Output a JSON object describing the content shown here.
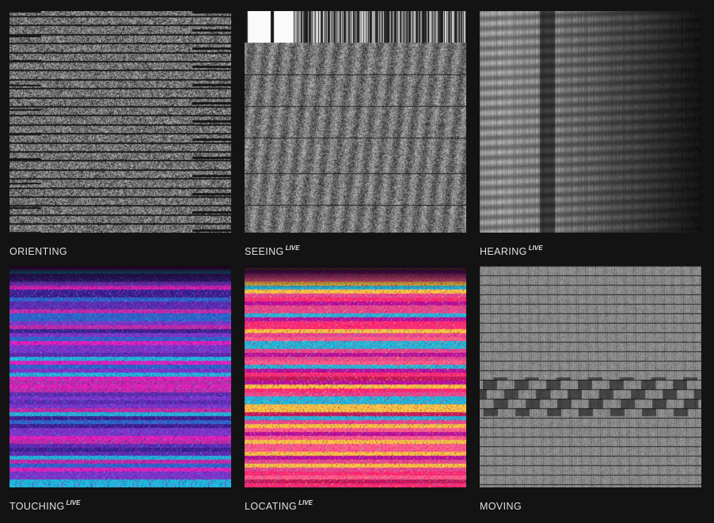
{
  "tiles": [
    {
      "id": "orienting",
      "label": "ORIENTING",
      "live": "",
      "style": "noise-gray"
    },
    {
      "id": "seeing",
      "label": "SEEING",
      "live": "LIVE",
      "style": "vertical-bars-noise"
    },
    {
      "id": "hearing",
      "label": "HEARING",
      "live": "LIVE",
      "style": "spectrogram"
    },
    {
      "id": "touching",
      "label": "TOUCHING",
      "live": "LIVE",
      "style": "gradient-purple"
    },
    {
      "id": "locating",
      "label": "LOCATING",
      "live": "LIVE",
      "style": "gradient-pink"
    },
    {
      "id": "moving",
      "label": "MOVING",
      "live": "",
      "style": "vertical-streaks"
    }
  ],
  "colors": {
    "background": "#131313",
    "caption": "#e0e0e0",
    "purple": "#7a35c9",
    "magenta": "#e01fb8",
    "cyan": "#1fb7d9",
    "pink": "#ff2a73",
    "yellow": "#f6c340"
  }
}
